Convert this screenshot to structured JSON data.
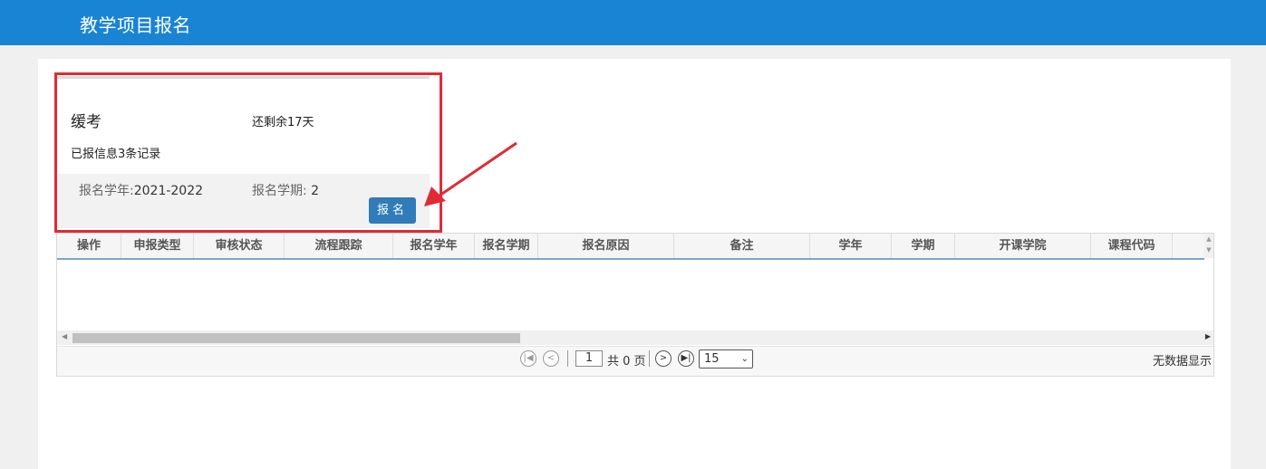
{
  "header": {
    "title": "教学项目报名"
  },
  "card": {
    "name": "缓考",
    "remaining": "还剩余17天",
    "records": "已报信息3条记录",
    "year_label": "报名学年:",
    "year_value": "2021-2022",
    "term_label": "报名学期:",
    "term_value": " 2",
    "button": "报名"
  },
  "grid": {
    "columns": [
      "操作",
      "申报类型",
      "审核状态",
      "流程跟踪",
      "报名学年",
      "报名学期",
      "报名原因",
      "备注",
      "学年",
      "学期",
      "开课学院",
      "课程代码"
    ],
    "rows": []
  },
  "pager": {
    "page": "1",
    "total_text": "共 0 页",
    "page_size": "15",
    "status": "无数据显示"
  },
  "colors": {
    "header": "#1a84d4",
    "button": "#2f7cb8",
    "highlight": "#e02b35"
  }
}
